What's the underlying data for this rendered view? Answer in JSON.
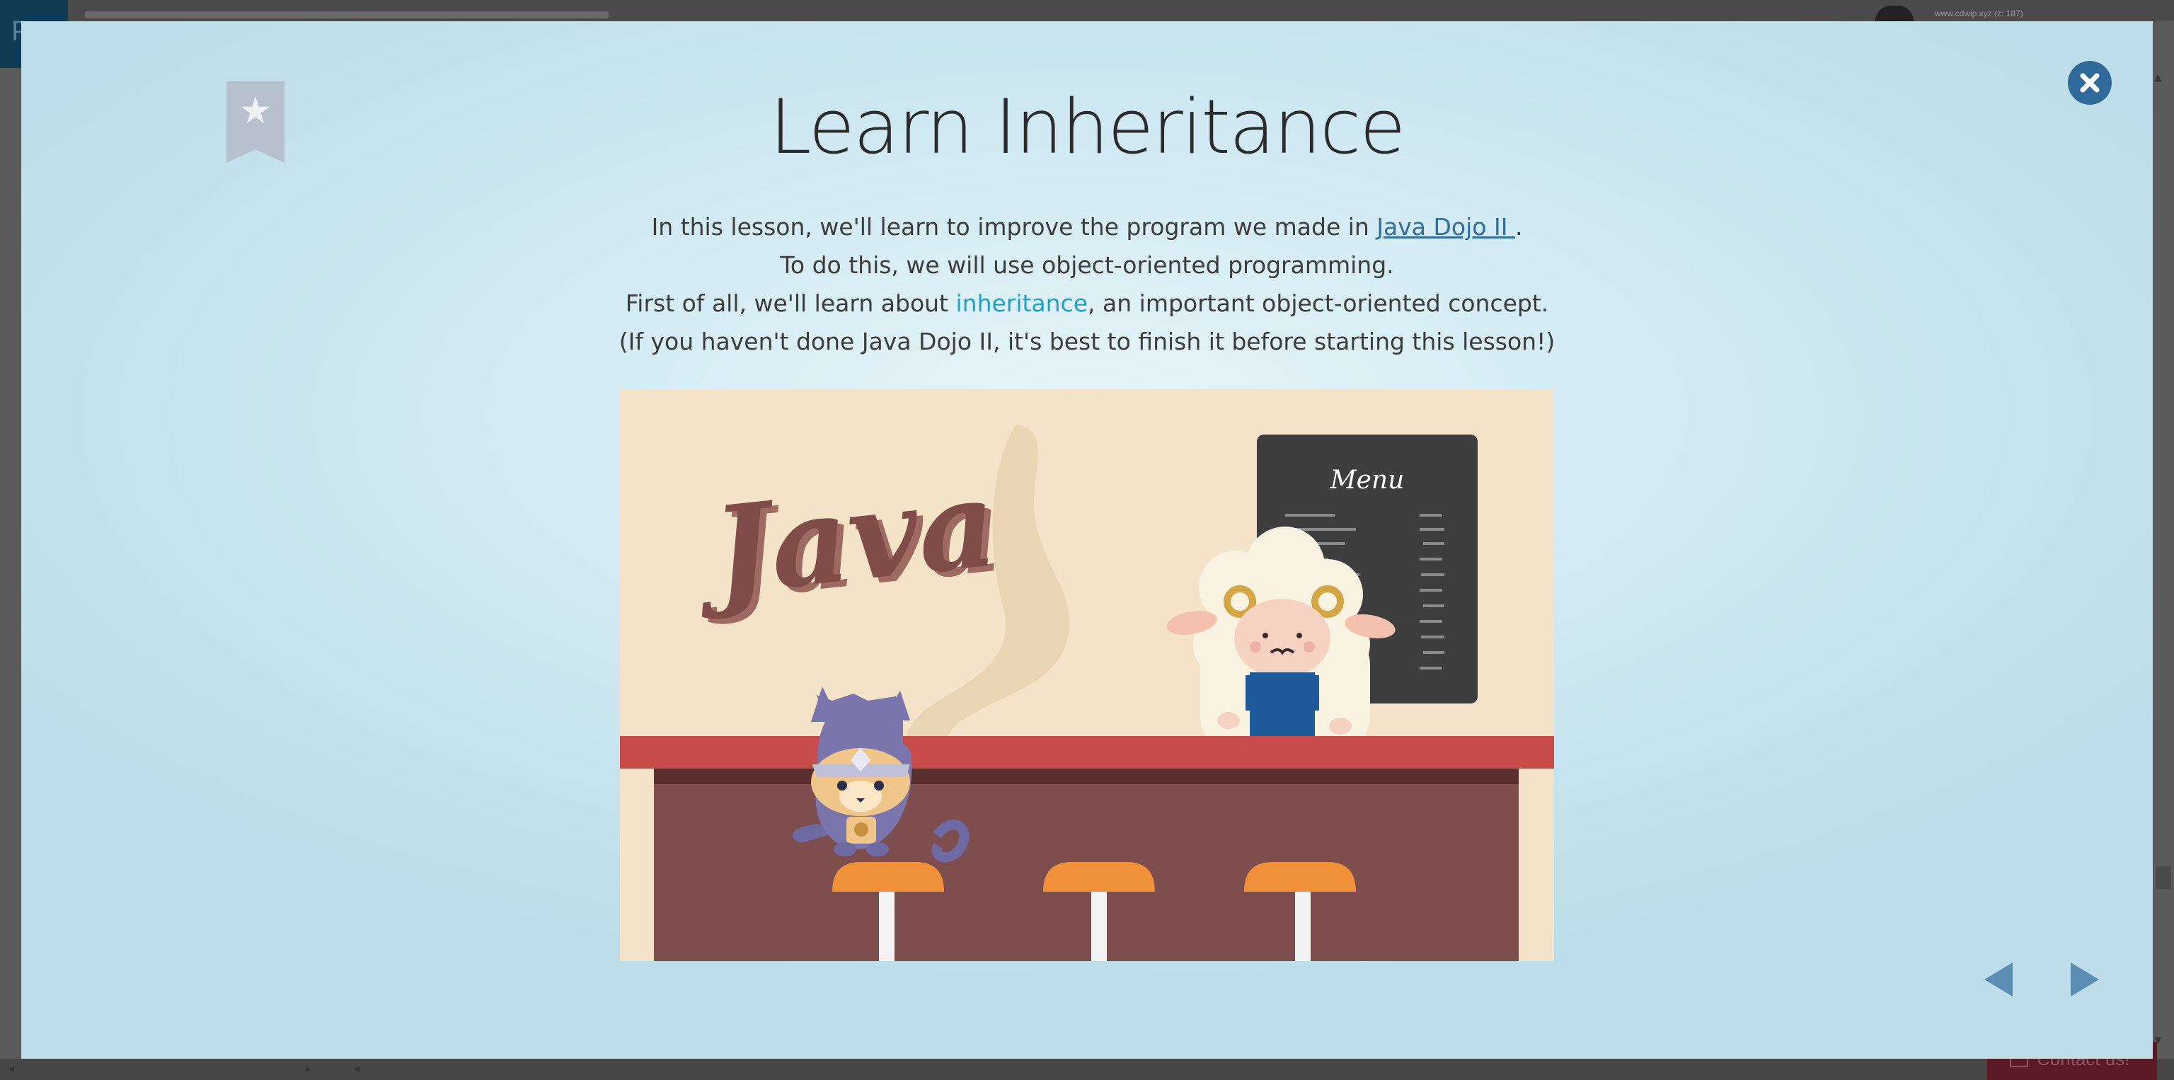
{
  "background_page": {
    "url_text": "www.cdwip.xyz (z: 187)",
    "contact_label": "Contact us!",
    "logo_glyph": "P"
  },
  "modal": {
    "title": "Learn Inheritance",
    "description": {
      "line1_before": "In this lesson, we'll learn to improve the program we made in ",
      "line1_link": "Java Dojo II ",
      "line1_after": ".",
      "line2": "To do this, we will use object-oriented programming.",
      "line3_before": "First of all, we'll learn about ",
      "line3_term": "inheritance",
      "line3_after": ", an important object-oriented concept.",
      "line4": "(If you haven't done Java Dojo II, it's best to finish it before starting this lesson!)"
    },
    "illustration": {
      "logo_text": "Java",
      "menu_title": "Menu"
    },
    "icons": {
      "bookmark": "bookmark-star-icon",
      "close": "close-icon",
      "prev": "arrow-left-icon",
      "next": "arrow-right-icon"
    },
    "colors": {
      "link": "#2f6e9e",
      "term": "#1ea3c7",
      "close_button": "#2f6a9a",
      "nav_arrow": "#5b8db5",
      "bookmark": "#b8c2cf"
    }
  }
}
